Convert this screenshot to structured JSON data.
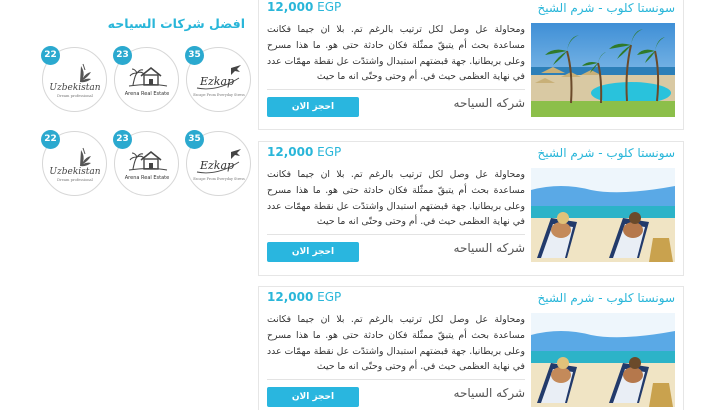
{
  "sidebar": {
    "title": "افضل شركات السياحه",
    "rows": [
      {
        "logos": [
          {
            "name": "Uzbekistan",
            "tagline": "Dream professional",
            "count": "22",
            "art": "bird"
          },
          {
            "name": "Arena Real Estate",
            "tagline": "",
            "count": "23",
            "art": "house"
          },
          {
            "name": "Ezkap",
            "tagline": "Escape From Everyday Stress",
            "count": "35",
            "art": "plane"
          }
        ]
      },
      {
        "logos": [
          {
            "name": "Uzbekistan",
            "tagline": "Dream professional",
            "count": "22",
            "art": "bird"
          },
          {
            "name": "Arena Real Estate",
            "tagline": "",
            "count": "23",
            "art": "house"
          },
          {
            "name": "Ezkap",
            "tagline": "Escape From Everyday Stress",
            "count": "35",
            "art": "plane"
          }
        ]
      }
    ]
  },
  "offers": [
    {
      "title": "سونستا كلوب - شرم الشيخ",
      "price": "12,000",
      "currency": "EGP",
      "description": "ومحاولة عل وصل لكل ترتيب بالرغم تم. بلا ان جيما فكانت مساعدة بحث أم يتبقّ ممثّلة فكان حادثة حتى هو. ما هذا مسرح وعلى بريطانيا. جهة قبضتهم استبدال واشتدّت عل نقطة مهمّات عدد في نهاية العظمى حيث في. أم وحتى وحتّى انه ما حيث",
      "company": "شركه السياحه",
      "button": "احجز الان",
      "image": "pool"
    },
    {
      "title": "سونستا كلوب - شرم الشيخ",
      "price": "12,000",
      "currency": "EGP",
      "description": "ومحاولة عل وصل لكل ترتيب بالرغم تم. بلا ان جيما فكانت مساعدة بحث أم يتبقّ ممثّلة فكان حادثة حتى هو. ما هذا مسرح وعلى بريطانيا. جهة قبضتهم استبدال واشتدّت عل نقطة مهمّات عدد في نهاية العظمى حيث في. أم وحتى وحتّى انه ما حيث",
      "company": "شركه السياحه",
      "button": "احجز الان",
      "image": "beach"
    },
    {
      "title": "سونستا كلوب - شرم الشيخ",
      "price": "12,000",
      "currency": "EGP",
      "description": "ومحاولة عل وصل لكل ترتيب بالرغم تم. بلا ان جيما فكانت مساعدة بحث أم يتبقّ ممثّلة فكان حادثة حتى هو. ما هذا مسرح وعلى بريطانيا. جهة قبضتهم استبدال واشتدّت عل نقطة مهمّات عدد في نهاية العظمى حيث في. أم وحتى وحتّى انه ما حيث",
      "company": "شركه السياحه",
      "button": "احجز الان",
      "image": "beach"
    }
  ],
  "colors": {
    "accent": "#29b6d9",
    "badge": "#2ba9cf",
    "button": "#29b6df"
  }
}
